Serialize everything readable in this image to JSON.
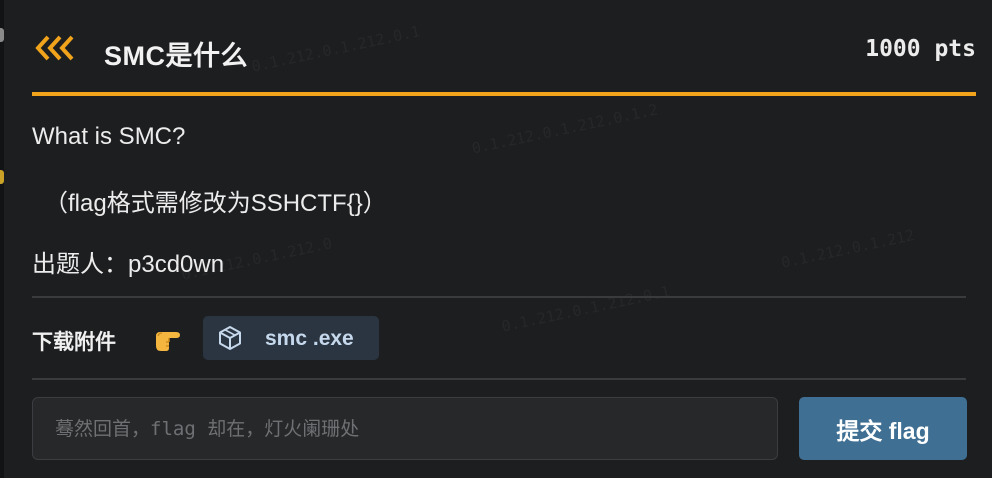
{
  "header": {
    "back_icon": "triple-chevron-left-icon",
    "title": "SMC是什么",
    "points": "1000 pts"
  },
  "colors": {
    "accent": "#f0a31b",
    "button": "#3f6f93",
    "chip": "#2b3541",
    "background": "#1d1e20"
  },
  "description": {
    "line1": "What is SMC?",
    "line2": "（flag格式需修改为SSHCTF{}）",
    "line3": "出题人：p3cd0wn"
  },
  "attachments": {
    "label": "下载附件",
    "pointer_icon": "pointing-hand-icon",
    "files": [
      {
        "icon": "package-icon",
        "name": "smc .exe"
      }
    ]
  },
  "submit": {
    "placeholder": "蓦然回首，flag 却在，灯火阑珊处",
    "value": "",
    "button_label": "提交 flag"
  }
}
